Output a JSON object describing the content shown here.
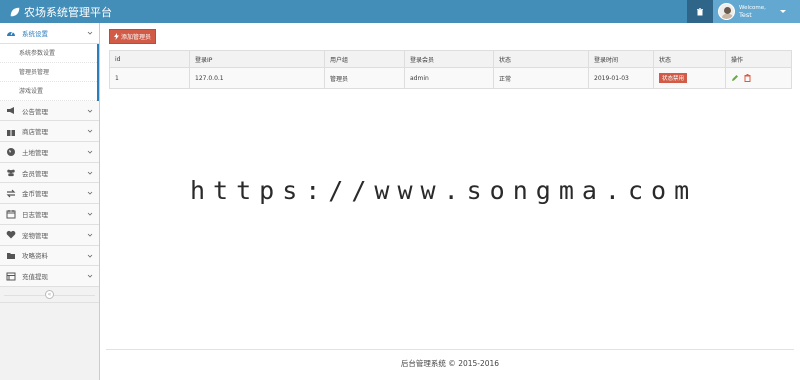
{
  "header": {
    "brand_title": "农场系统管理平台",
    "welcome_label": "Welcome,",
    "username": "Test",
    "bg_color": "#438eb9"
  },
  "sidebar": {
    "items": [
      {
        "label": "系统设置",
        "icon": "dashboard-icon",
        "active": true
      },
      {
        "label": "公告管理",
        "icon": "bullhorn-icon"
      },
      {
        "label": "商店管理",
        "icon": "gift-icon"
      },
      {
        "label": "土地管理",
        "icon": "globe-icon"
      },
      {
        "label": "会员管理",
        "icon": "users-icon"
      },
      {
        "label": "金币管理",
        "icon": "exchange-icon"
      },
      {
        "label": "日志管理",
        "icon": "calendar-icon"
      },
      {
        "label": "宠物管理",
        "icon": "heart-icon"
      },
      {
        "label": "攻略资料",
        "icon": "folder-icon"
      },
      {
        "label": "充值提现",
        "icon": "list-icon"
      }
    ],
    "subitems": [
      "系统参数设置",
      "管理员管理",
      "游戏设置"
    ]
  },
  "toolbar": {
    "add_button_label": "添加管理员"
  },
  "table": {
    "headers": [
      "id",
      "登录IP",
      "用户组",
      "登录会员",
      "状态",
      "登录时间",
      "状态",
      "操作"
    ],
    "rows": [
      {
        "id": "1",
        "ip": "127.0.0.1",
        "group": "管理员",
        "member": "admin",
        "status": "正常",
        "time": "2019-01-03",
        "action_status": "状态禁用"
      }
    ]
  },
  "watermark": "https://www.songma.com",
  "footer": {
    "text": "后台管理系统 © 2015-2016"
  },
  "colors": {
    "accent": "#2b7dbc",
    "danger": "#d15b47",
    "success": "#69aa46"
  }
}
